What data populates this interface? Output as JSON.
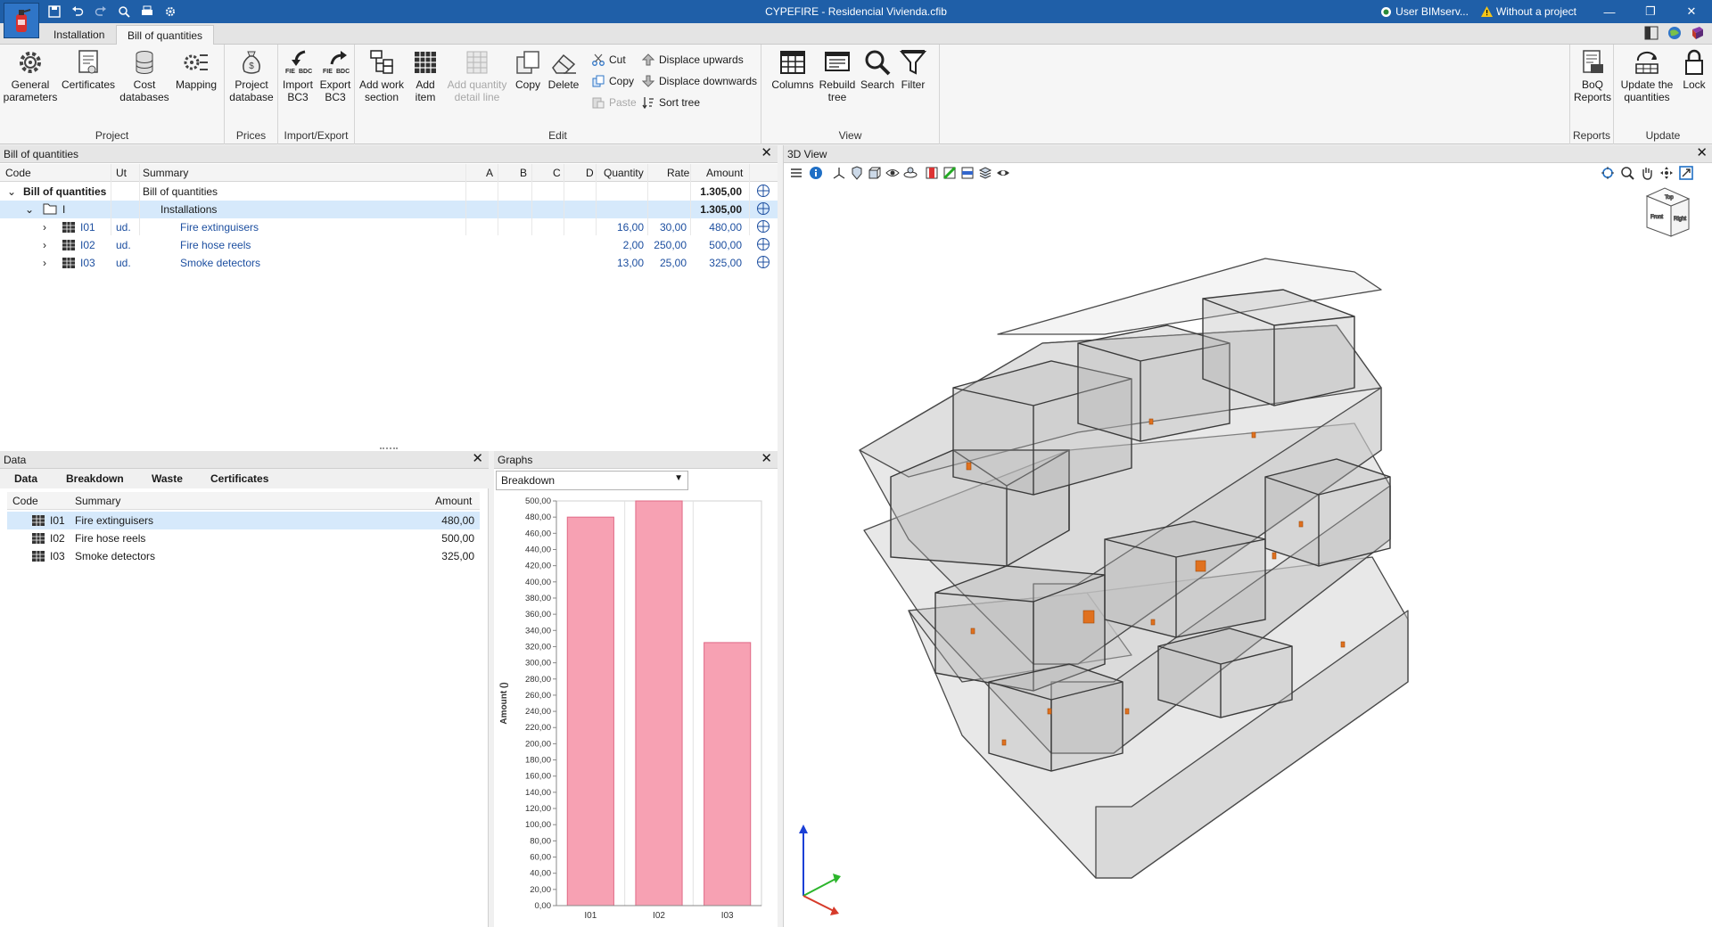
{
  "window": {
    "title": "CYPEFIRE - Residencial Vivienda.cfib",
    "user": "User BIMserv...",
    "project_status": "Without a project"
  },
  "tabs": [
    {
      "label": "Installation"
    },
    {
      "label": "Bill of quantities"
    }
  ],
  "ribbon": {
    "project": {
      "label": "Project",
      "buttons": [
        "General parameters",
        "Certificates",
        "Cost databases",
        "Mapping"
      ]
    },
    "prices": {
      "label": "Prices",
      "buttons": [
        "Project database"
      ]
    },
    "import_export": {
      "label": "Import/Export",
      "buttons": [
        "Import BC3",
        "Export BC3"
      ]
    },
    "edit": {
      "label": "Edit",
      "buttons": [
        "Add work section",
        "Add item",
        "Add quantity detail line",
        "Copy",
        "Delete"
      ],
      "small": [
        "Cut",
        "Copy",
        "Paste",
        "Displace upwards",
        "Displace downwards",
        "Sort tree"
      ]
    },
    "view": {
      "label": "View",
      "buttons": [
        "Columns",
        "Rebuild tree",
        "Search",
        "Filter"
      ]
    },
    "reports": {
      "label": "Reports",
      "buttons": [
        "BoQ Reports"
      ]
    },
    "update": {
      "label": "Update",
      "buttons": [
        "Update the quantities",
        "Lock"
      ]
    }
  },
  "boq": {
    "title": "Bill of quantities",
    "columns": [
      "Code",
      "Ut",
      "Summary",
      "A",
      "B",
      "C",
      "D",
      "Quantity",
      "Rate",
      "Amount"
    ],
    "rows": [
      {
        "code": "Bill of quantities",
        "ut": "",
        "summary": "Bill of quantities",
        "quantity": "",
        "rate": "",
        "amount": "1.305,00"
      },
      {
        "code": "I",
        "ut": "",
        "summary": "Installations",
        "quantity": "",
        "rate": "",
        "amount": "1.305,00"
      },
      {
        "code": "I01",
        "ut": "ud.",
        "summary": "Fire extinguisers",
        "quantity": "16,00",
        "rate": "30,00",
        "amount": "480,00"
      },
      {
        "code": "I02",
        "ut": "ud.",
        "summary": "Fire hose reels",
        "quantity": "2,00",
        "rate": "250,00",
        "amount": "500,00"
      },
      {
        "code": "I03",
        "ut": "ud.",
        "summary": "Smoke detectors",
        "quantity": "13,00",
        "rate": "25,00",
        "amount": "325,00"
      }
    ]
  },
  "data_panel": {
    "title": "Data",
    "tabs": [
      "Data",
      "Breakdown",
      "Waste",
      "Certificates"
    ],
    "columns": [
      "Code",
      "Summary",
      "Amount"
    ],
    "rows": [
      {
        "code": "I01",
        "summary": "Fire extinguisers",
        "amount": "480,00"
      },
      {
        "code": "I02",
        "summary": "Fire hose reels",
        "amount": "500,00"
      },
      {
        "code": "I03",
        "summary": "Smoke detectors",
        "amount": "325,00"
      }
    ]
  },
  "graphs_panel": {
    "title": "Graphs",
    "selected_option": "Breakdown"
  },
  "view3d": {
    "title": "3D View",
    "viewcube_faces": [
      "Top",
      "Front",
      "Right"
    ]
  },
  "colors": {
    "titlebar": "#1f5fa8",
    "bar": "#f7a1b3",
    "bar_border": "#e06a86",
    "selection": "#d6e9fb",
    "link_blue": "#1d4fa0"
  },
  "chart_data": {
    "type": "bar",
    "categories": [
      "I01",
      "I02",
      "I03"
    ],
    "values": [
      480,
      500,
      325
    ],
    "ylabel": "Amount ()",
    "ylim": [
      0,
      500
    ],
    "ytick_step": 20,
    "tick_format": "decimal-comma-2",
    "grid": true
  }
}
